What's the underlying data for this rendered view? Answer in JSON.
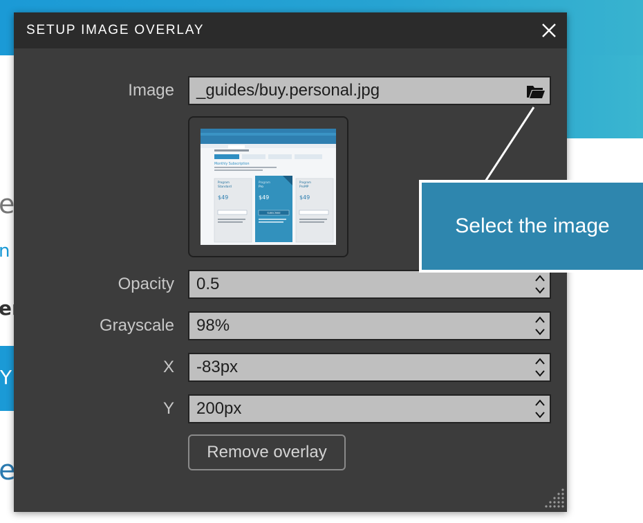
{
  "background": {
    "text_1": "e",
    "text_2": "n",
    "text_3": "er",
    "button_text": "Y",
    "text_4": "e",
    "colors": {
      "banner": "#1b9ad6",
      "banner_light": "#38b3cf"
    }
  },
  "dialog": {
    "title": "SETUP IMAGE OVERLAY",
    "close_icon": "close-icon",
    "image": {
      "label": "Image",
      "value": "_guides/buy.personal.jpg",
      "browse_icon": "folder-open-icon"
    },
    "preview": {
      "header": "Monthly Subscription",
      "plans": [
        {
          "name": "Program",
          "title": "Standard",
          "price": "$49"
        },
        {
          "name": "Program",
          "title": "Pro",
          "price": "$49",
          "button": "SUBSCRIBE"
        },
        {
          "name": "Program",
          "title": "ProMP",
          "price": "$49"
        }
      ]
    },
    "opacity": {
      "label": "Opacity",
      "value": "0.5"
    },
    "grayscale": {
      "label": "Grayscale",
      "value": "98%"
    },
    "x": {
      "label": "X",
      "value": "-83px"
    },
    "y": {
      "label": "Y",
      "value": "200px"
    },
    "remove_button": "Remove overlay",
    "colors": {
      "body": "#3c3c3c",
      "header": "#2b2b2b",
      "field": "#bfbfbf"
    }
  },
  "callout": {
    "text": "Select the image",
    "color": "#2e86ae"
  }
}
